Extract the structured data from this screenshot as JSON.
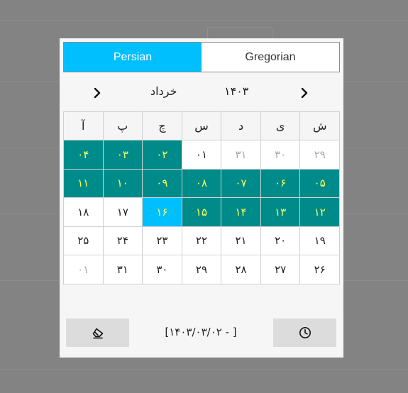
{
  "background": {
    "labels": [
      "",
      ""
    ]
  },
  "tabs": [
    {
      "label": "Persian",
      "active": true
    },
    {
      "label": "Gregorian",
      "active": false
    }
  ],
  "nav": {
    "year": "۱۴۰۳",
    "month": "خرداد"
  },
  "weekdays": [
    "ش",
    "ی",
    "د",
    "س",
    "چ",
    "پ",
    "آ"
  ],
  "weeks": [
    [
      {
        "label": "۲۹",
        "state": "other"
      },
      {
        "label": "۳۰",
        "state": "other"
      },
      {
        "label": "۳۱",
        "state": "other"
      },
      {
        "label": "۰۱",
        "state": "normal"
      },
      {
        "label": "۰۲",
        "state": "selected"
      },
      {
        "label": "۰۳",
        "state": "selected"
      },
      {
        "label": "۰۴",
        "state": "selected"
      }
    ],
    [
      {
        "label": "۰۵",
        "state": "selected"
      },
      {
        "label": "۰۶",
        "state": "selected"
      },
      {
        "label": "۰۷",
        "state": "selected"
      },
      {
        "label": "۰۸",
        "state": "selected"
      },
      {
        "label": "۰۹",
        "state": "selected"
      },
      {
        "label": "۱۰",
        "state": "selected"
      },
      {
        "label": "۱۱",
        "state": "selected"
      }
    ],
    [
      {
        "label": "۱۲",
        "state": "selected"
      },
      {
        "label": "۱۳",
        "state": "selected"
      },
      {
        "label": "۱۴",
        "state": "selected"
      },
      {
        "label": "۱۵",
        "state": "selected"
      },
      {
        "label": "۱۶",
        "state": "today"
      },
      {
        "label": "۱۷",
        "state": "normal"
      },
      {
        "label": "۱۸",
        "state": "normal"
      }
    ],
    [
      {
        "label": "۱۹",
        "state": "normal"
      },
      {
        "label": "۲۰",
        "state": "normal"
      },
      {
        "label": "۲۱",
        "state": "normal"
      },
      {
        "label": "۲۲",
        "state": "normal"
      },
      {
        "label": "۲۳",
        "state": "normal"
      },
      {
        "label": "۲۴",
        "state": "normal"
      },
      {
        "label": "۲۵",
        "state": "normal"
      }
    ],
    [
      {
        "label": "۲۶",
        "state": "normal"
      },
      {
        "label": "۲۷",
        "state": "normal"
      },
      {
        "label": "۲۸",
        "state": "normal"
      },
      {
        "label": "۲۹",
        "state": "normal"
      },
      {
        "label": "۳۰",
        "state": "normal"
      },
      {
        "label": "۳۱",
        "state": "normal"
      },
      {
        "label": "۰۱",
        "state": "other"
      }
    ]
  ],
  "footer": {
    "range_text": "[۱۴۰۳/۰۳/۰۲ - ]",
    "clear_icon": "eraser-icon",
    "time_icon": "clock-icon"
  },
  "colors": {
    "tab_active": "#00bfff",
    "range_selected": "#008b8b",
    "today": "#00bfff",
    "selected_text": "#ffff55",
    "overlay": "#838383"
  }
}
